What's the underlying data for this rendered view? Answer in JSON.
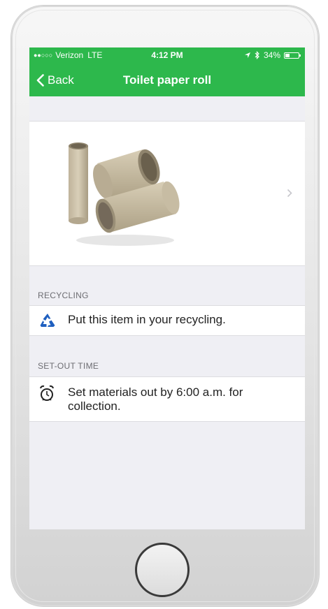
{
  "status_bar": {
    "signal_dots": "●●○○○",
    "carrier": "Verizon",
    "network": "LTE",
    "time": "4:12 PM",
    "battery": "34%",
    "battery_level": 0.34
  },
  "nav": {
    "back_label": "Back",
    "title": "Toilet paper roll"
  },
  "item_image": {
    "icon": "toilet-paper-rolls-image",
    "chevron": "chevron-right-icon"
  },
  "sections": [
    {
      "header": "RECYCLING",
      "icon": "recycle-icon",
      "text": "Put this item in your recycling."
    },
    {
      "header": "SET-OUT TIME",
      "icon": "alarm-clock-icon",
      "text": "Set materials out by 6:00 a.m. for collection."
    }
  ],
  "colors": {
    "accent": "#2db84c",
    "background": "#efeff4",
    "recycle": "#1f5fbf"
  }
}
